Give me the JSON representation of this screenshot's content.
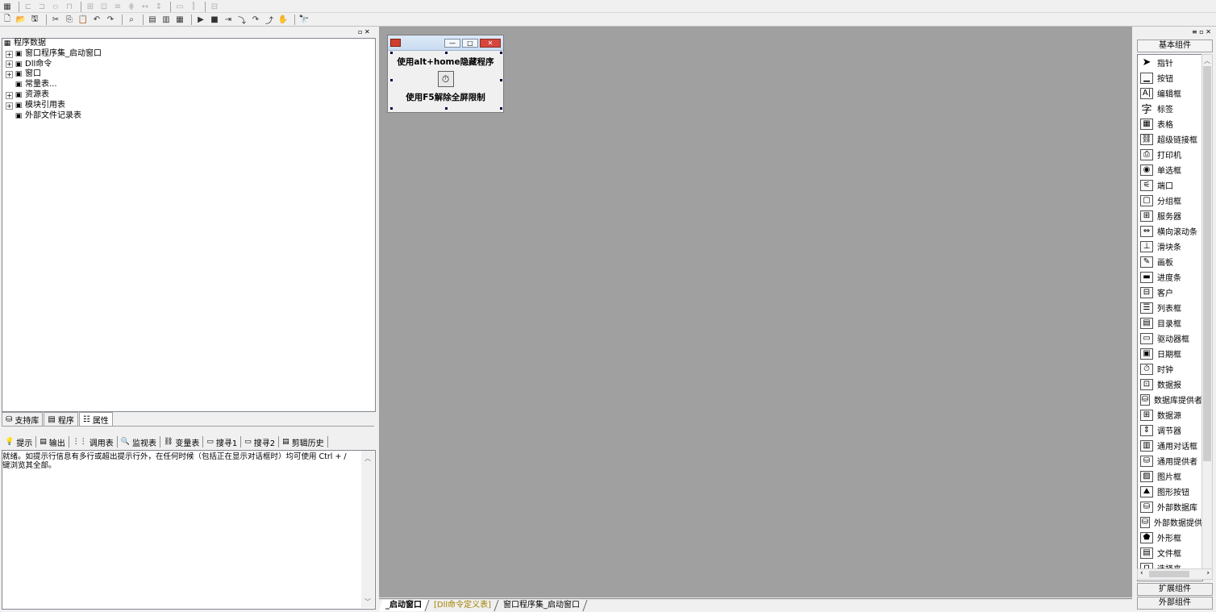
{
  "toolbar1": {
    "icons": [
      "grid-icon",
      "align-left-icon",
      "align-center-icon",
      "align-right-icon",
      "align-top-icon",
      "same-size-icon",
      "center-icon",
      "space-h-icon",
      "space-v-icon",
      "width-icon",
      "height-icon",
      "size-icon",
      "dist-icon",
      "group-icon"
    ]
  },
  "toolbar2": {
    "icons": [
      "new-file-icon",
      "open-file-icon",
      "save-icon",
      "cut-icon",
      "copy-icon",
      "paste-icon",
      "undo-icon",
      "redo-icon",
      "find-icon",
      "layout1-icon",
      "layout2-icon",
      "layout3-icon",
      "run-icon",
      "stop-icon",
      "step-icon",
      "step-into-icon",
      "step-over-icon",
      "step-out-icon",
      "breakpoint-icon",
      "binoculars-icon"
    ]
  },
  "tree": {
    "root": "程序数据",
    "items": [
      {
        "label": "窗口程序集_启动窗口",
        "expand": "+"
      },
      {
        "label": "Dll命令",
        "expand": "+"
      },
      {
        "label": "窗口",
        "expand": "+"
      },
      {
        "label": "常量表...",
        "expand": ""
      },
      {
        "label": "资源表",
        "expand": "+"
      },
      {
        "label": "模块引用表",
        "expand": "+"
      },
      {
        "label": "外部文件记录表",
        "expand": ""
      }
    ]
  },
  "left_tabs": [
    {
      "label": "支持库"
    },
    {
      "label": "程序"
    },
    {
      "label": "属性"
    }
  ],
  "output_tabs": [
    {
      "label": "提示"
    },
    {
      "label": "输出"
    },
    {
      "label": "调用表"
    },
    {
      "label": "监视表"
    },
    {
      "label": "变量表"
    },
    {
      "label": "搜寻1"
    },
    {
      "label": "搜寻2"
    },
    {
      "label": "剪辑历史"
    }
  ],
  "output": {
    "line1": "就绪。如提示行信息有多行或超出提示行外，在任何时候（包括正在显示对话框时）均可使用 Ctrl + /",
    "line2": "键浏览其全部。"
  },
  "form": {
    "label1": "使用alt+home隐藏程序",
    "label2": "使用F5解除全屏限制"
  },
  "doc_tabs": [
    {
      "label": "_启动窗口"
    },
    {
      "label": "[Dll命令定义表]"
    },
    {
      "label": "窗口程序集_启动窗口"
    }
  ],
  "components": {
    "header": "基本组件",
    "items": [
      {
        "label": "指针",
        "icon": "➤"
      },
      {
        "label": "按钮",
        "icon": "▁"
      },
      {
        "label": "编辑框",
        "icon": "A|"
      },
      {
        "label": "标签",
        "icon": "字"
      },
      {
        "label": "表格",
        "icon": "▦"
      },
      {
        "label": "超级链接框",
        "icon": "⛓"
      },
      {
        "label": "打印机",
        "icon": "⎙"
      },
      {
        "label": "单选框",
        "icon": "◉"
      },
      {
        "label": "端口",
        "icon": "⚟"
      },
      {
        "label": "分组框",
        "icon": "▢"
      },
      {
        "label": "服务器",
        "icon": "⊞"
      },
      {
        "label": "横向滚动条",
        "icon": "⇔"
      },
      {
        "label": "滑块条",
        "icon": "⊥"
      },
      {
        "label": "画板",
        "icon": "✎"
      },
      {
        "label": "进度条",
        "icon": "▬"
      },
      {
        "label": "客户",
        "icon": "⊟"
      },
      {
        "label": "列表框",
        "icon": "☰"
      },
      {
        "label": "目录框",
        "icon": "▤"
      },
      {
        "label": "驱动器框",
        "icon": "▭"
      },
      {
        "label": "日期框",
        "icon": "▣"
      },
      {
        "label": "时钟",
        "icon": "⏱"
      },
      {
        "label": "数据报",
        "icon": "⊡"
      },
      {
        "label": "数据库提供者",
        "icon": "⛁"
      },
      {
        "label": "数据源",
        "icon": "⊞"
      },
      {
        "label": "调节器",
        "icon": "⇕"
      },
      {
        "label": "通用对话框",
        "icon": "▥"
      },
      {
        "label": "通用提供者",
        "icon": "⛁"
      },
      {
        "label": "图片框",
        "icon": "▨"
      },
      {
        "label": "图形按钮",
        "icon": "⛰"
      },
      {
        "label": "外部数据库",
        "icon": "⛁"
      },
      {
        "label": "外部数据提供",
        "icon": "⛁"
      },
      {
        "label": "外形框",
        "icon": "⬟"
      },
      {
        "label": "文件框",
        "icon": "▤"
      },
      {
        "label": "选择夹",
        "icon": "⊓"
      }
    ],
    "footer1": "扩展组件",
    "footer2": "外部组件"
  }
}
